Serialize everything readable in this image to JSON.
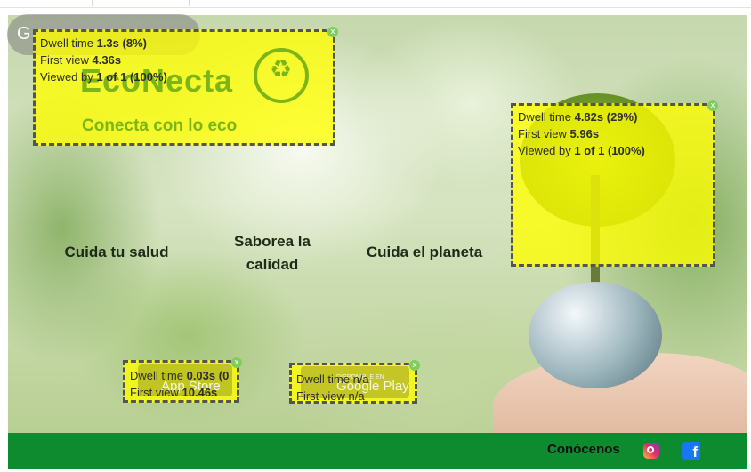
{
  "top_overlay_left": {
    "dwell": "1.3s (8%)",
    "first_view": "4.36s",
    "viewed_by": "1 of 1 (100%)"
  },
  "logo": {
    "word": "EcoNecta",
    "subtitle": "Conecta con lo eco"
  },
  "top_overlay_right": {
    "dwell": "4.82s (29%)",
    "first_view": "5.96s",
    "viewed_by": "1 of 1 (100%)"
  },
  "taglines": {
    "left": "Cuida tu salud",
    "center_line1": "Saborea la",
    "center_line2": "calidad",
    "right": "Cuida el planeta"
  },
  "app_store_overlay": {
    "dwell": "0.03s (0",
    "first_view": "10.46s"
  },
  "google_play_overlay": {
    "dwell": "n/a",
    "first_view": "n/a"
  },
  "stores": {
    "app_store": "App Store",
    "google_play": "Google Play",
    "google_play_pre": "DISPONIBLE EN"
  },
  "labels": {
    "dwell": "Dwell time",
    "first_view": "First view",
    "viewed_by": "Viewed by",
    "close": "x"
  },
  "footer": {
    "label": "Conócenos"
  },
  "google": {
    "letter": "G"
  },
  "icons": {
    "instagram": "instagram-icon",
    "facebook": "facebook-icon"
  },
  "colors": {
    "brand_green": "#0e8a2f",
    "overlay_yellow": "#ffff00",
    "logo_green": "#7cb518"
  }
}
